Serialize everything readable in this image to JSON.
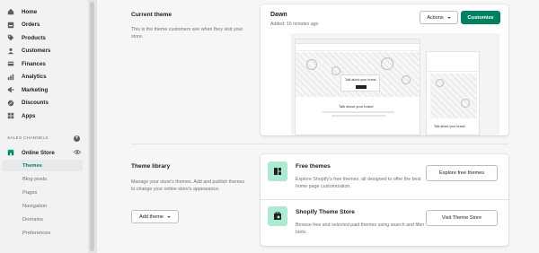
{
  "sidebar": {
    "items": [
      {
        "label": "Home",
        "icon": "home-icon"
      },
      {
        "label": "Orders",
        "icon": "orders-icon"
      },
      {
        "label": "Products",
        "icon": "tag-icon"
      },
      {
        "label": "Customers",
        "icon": "person-icon"
      },
      {
        "label": "Finances",
        "icon": "finances-icon"
      },
      {
        "label": "Analytics",
        "icon": "bar-chart-icon"
      },
      {
        "label": "Marketing",
        "icon": "megaphone-icon"
      },
      {
        "label": "Discounts",
        "icon": "discount-icon"
      },
      {
        "label": "Apps",
        "icon": "apps-icon"
      }
    ],
    "sales_channels_label": "SALES CHANNELS",
    "online_store_label": "Online Store",
    "sub_items": [
      "Themes",
      "Blog posts",
      "Pages",
      "Navigation",
      "Domains",
      "Preferences"
    ],
    "active_sub": "Themes"
  },
  "current_theme": {
    "heading": "Current theme",
    "description": "This is the theme customers see when they visit your store.",
    "theme_name": "Dawn",
    "added": "Added: 16 minutes ago",
    "actions_label": "Actions",
    "customize_label": "Customize",
    "preview_text": "Talk about your brand",
    "mobile_text": "Talk about your brand"
  },
  "theme_library": {
    "heading": "Theme library",
    "description": "Manage your store's themes. Add and publish themes to change your online store's appearance.",
    "add_theme_label": "Add theme",
    "free": {
      "title": "Free themes",
      "description": "Explore Shopify's free themes, all designed to offer the best home page customization.",
      "button": "Explore free themes"
    },
    "store": {
      "title": "Shopify Theme Store",
      "description": "Browse free and selected paid themes using search and filter tools.",
      "button": "Visit Theme Store"
    }
  },
  "colors": {
    "accent": "#008060",
    "feature_icon_bg": "#aee9d1"
  }
}
